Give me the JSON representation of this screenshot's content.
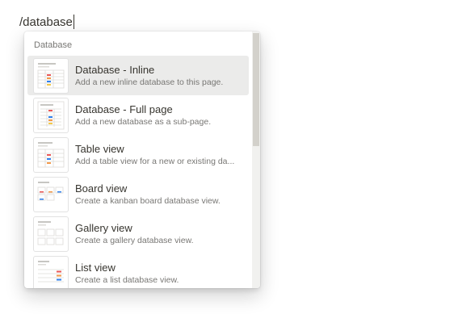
{
  "editor": {
    "typed_text": "/database"
  },
  "menu": {
    "section_label": "Database",
    "items": [
      {
        "title": "Database - Inline",
        "description": "Add a new inline database to this page.",
        "icon": "inline-database-icon",
        "selected": true
      },
      {
        "title": "Database - Full page",
        "description": "Add a new database as a sub-page.",
        "icon": "full-page-database-icon",
        "selected": false
      },
      {
        "title": "Table view",
        "description": "Add a table view for a new or existing da...",
        "icon": "table-view-icon",
        "selected": false
      },
      {
        "title": "Board view",
        "description": "Create a kanban board database view.",
        "icon": "board-view-icon",
        "selected": false
      },
      {
        "title": "Gallery view",
        "description": "Create a gallery database view.",
        "icon": "gallery-view-icon",
        "selected": false
      },
      {
        "title": "List view",
        "description": "Create a list database view.",
        "icon": "list-view-icon",
        "selected": false
      }
    ]
  },
  "colors": {
    "selected_background": "#ebebea",
    "text_primary": "#37352f",
    "text_secondary": "#787774",
    "tag_red": "#eb5757",
    "tag_orange": "#f2994a",
    "tag_blue": "#2f80ed",
    "tag_yellow": "#f2c94c"
  }
}
